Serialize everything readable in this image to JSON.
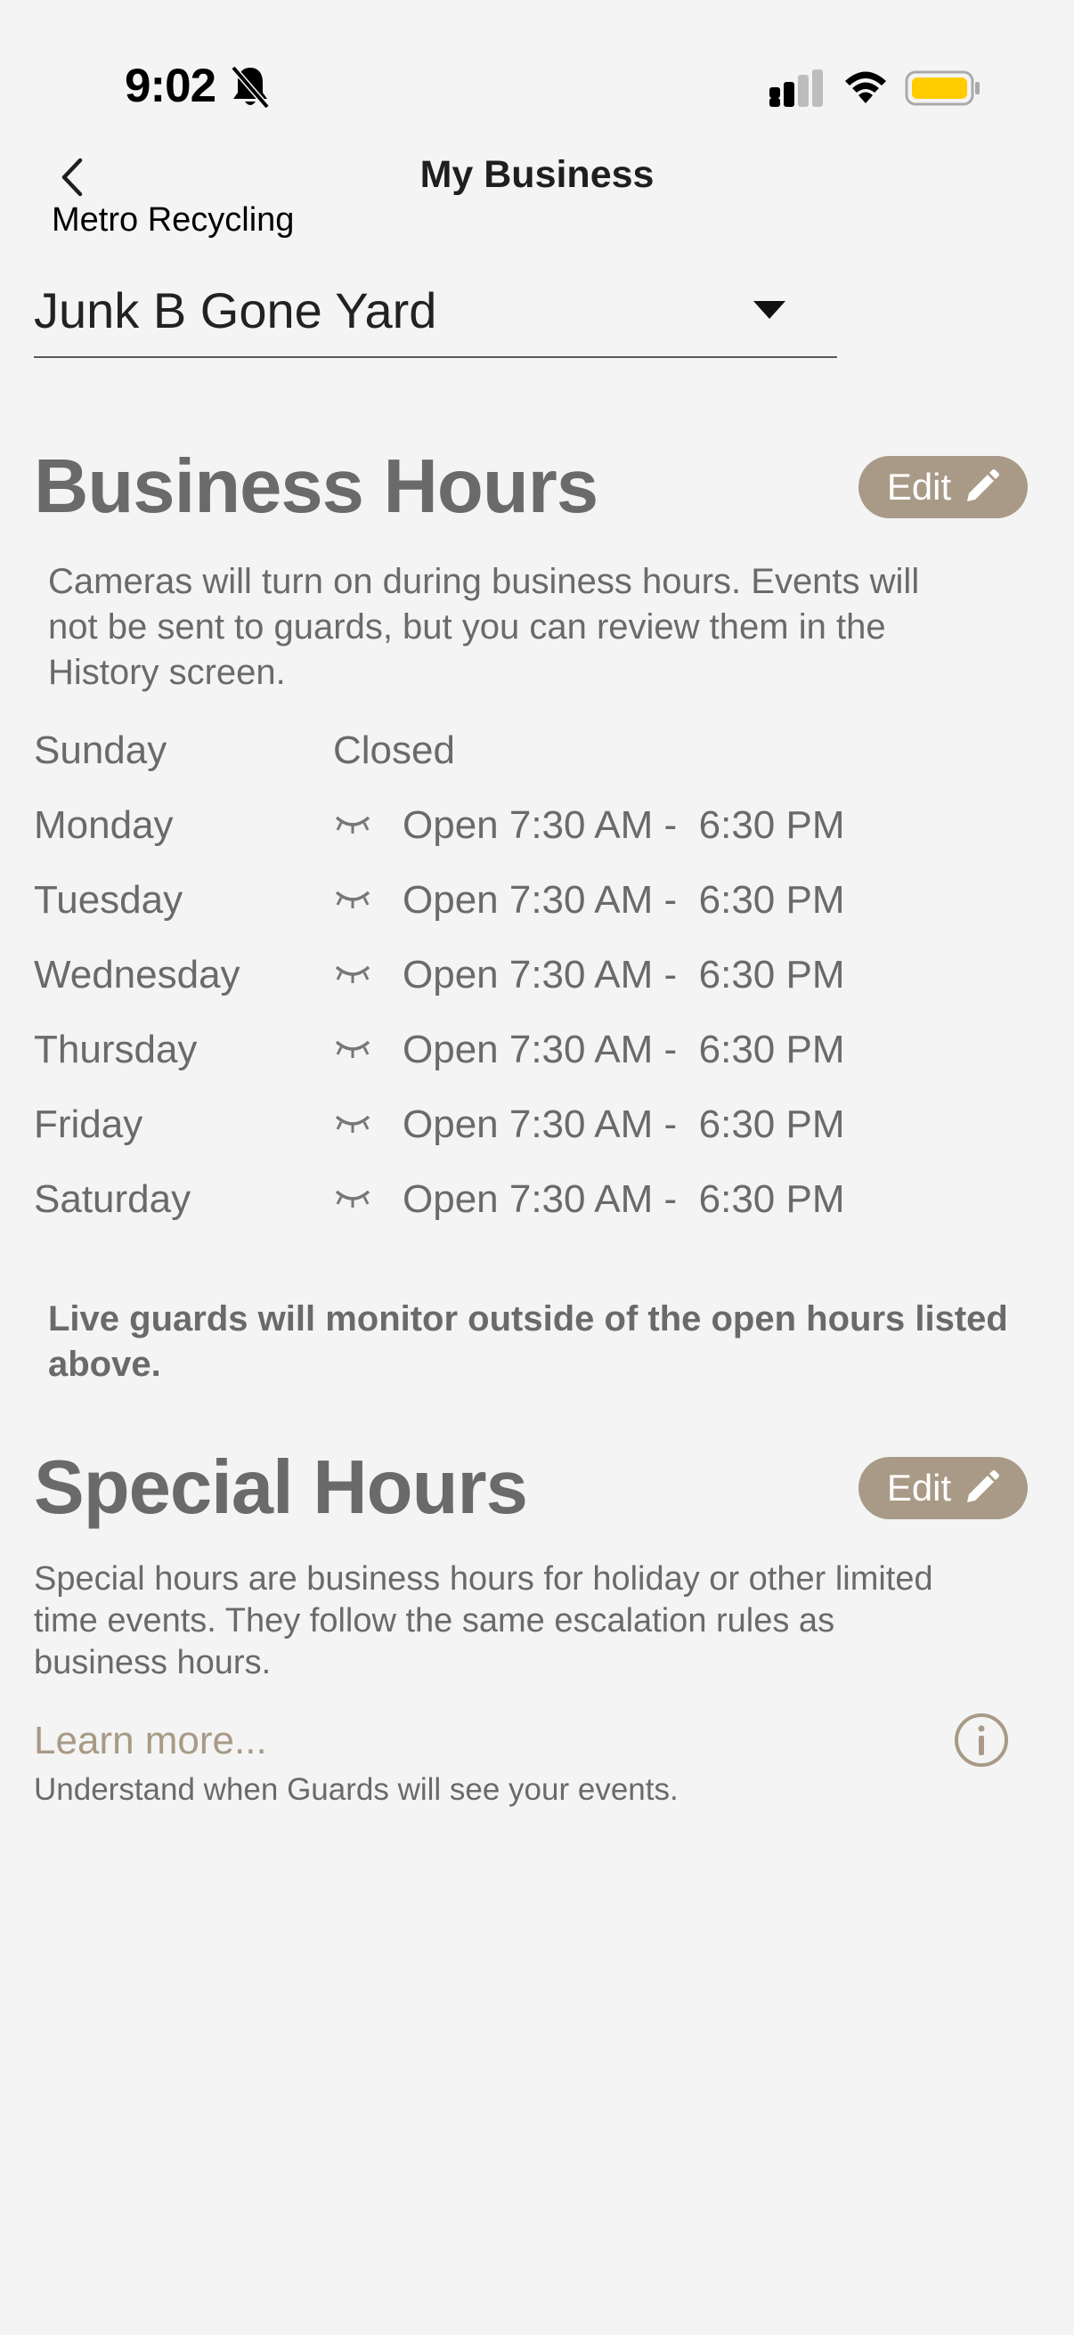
{
  "status_bar": {
    "time": "9:02"
  },
  "nav": {
    "title": "My Business",
    "back_label": "Metro Recycling"
  },
  "site_selector": {
    "value": "Junk B Gone Yard"
  },
  "business_hours": {
    "title": "Business Hours",
    "edit_label": "Edit",
    "description": "Cameras will turn on during business hours. Events will not be sent to guards, but you can review them in the History screen.",
    "days": [
      {
        "day": "Sunday",
        "status": "Closed"
      },
      {
        "day": "Monday",
        "status": "Open 7:30 AM -  6:30 PM"
      },
      {
        "day": "Tuesday",
        "status": "Open 7:30 AM -  6:30 PM"
      },
      {
        "day": "Wednesday",
        "status": "Open 7:30 AM -  6:30 PM"
      },
      {
        "day": "Thursday",
        "status": "Open 7:30 AM -  6:30 PM"
      },
      {
        "day": "Friday",
        "status": "Open 7:30 AM -  6:30 PM"
      },
      {
        "day": "Saturday",
        "status": "Open 7:30 AM -  6:30 PM"
      }
    ],
    "monitor_note": "Live guards will monitor outside of the open hours listed above."
  },
  "special_hours": {
    "title": "Special Hours",
    "edit_label": "Edit",
    "description": "Special hours are business hours for holiday or other limited time events. They follow the same escalation rules as business hours.",
    "learn_more": "Learn more...",
    "learn_more_sub": "Understand when Guards will see your events."
  },
  "colors": {
    "background": "#f4f4f4",
    "accent": "#a89a86",
    "text_gray": "#6a6a6a",
    "battery": "#ffcc00"
  },
  "icons": [
    "bell-slash-icon",
    "signal-icon",
    "wifi-icon",
    "battery-icon",
    "chevron-left-icon",
    "dropdown-caret-icon",
    "pencil-icon",
    "closed-eye-icon",
    "info-icon"
  ]
}
